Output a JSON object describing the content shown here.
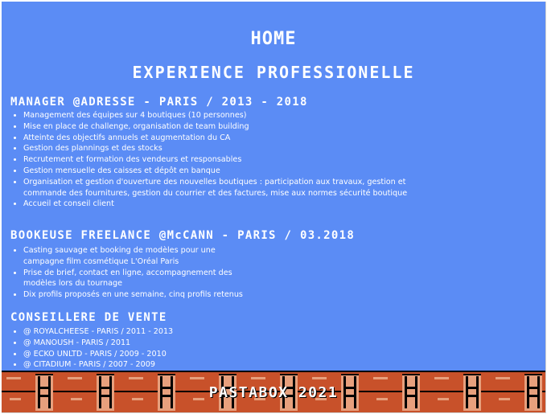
{
  "header": {
    "home": "HOME",
    "section_title": "EXPERIENCE PROFESSIONELLE"
  },
  "jobs": [
    {
      "title": "MANAGER @ADRESSE - PARIS / 2013 - 2018",
      "bullets": [
        "Management des équipes sur 4 boutiques (10 personnes)",
        "Mise en place de challenge, organisation de team building",
        "Atteinte des objectifs annuels et augmentation du CA",
        "Gestion des plannings et des stocks",
        "Recrutement et formation des vendeurs et responsables",
        "Gestion mensuelle des caisses et dépôt en banque",
        "Organisation et gestion d'ouverture des nouvelles boutiques : participation aux travaux, gestion et commande des fournitures, gestion du courrier et des factures, mise aux normes sécurité boutique",
        "Accueil et conseil client"
      ]
    },
    {
      "title": "BOOKEUSE FREELANCE @McCANN - PARIS / 03.2018",
      "bullets": [
        "Casting sauvage et booking de modèles pour une campagne film cosmétique L'Oréal Paris",
        "Prise de brief, contact en ligne, accompagnement des modèles lors du tournage",
        "Dix profils proposés en une semaine, cinq profils retenus"
      ]
    },
    {
      "title": "CONSEILLERE DE VENTE",
      "bullets": [
        "@ ROYALCHEESE - PARIS / 2011 - 2013",
        "@ MANOUSH - PARIS / 2011",
        "@ ECKO UNLTD - PARIS / 2009 - 2010",
        "@ CITADIUM - PARIS / 2007 - 2009"
      ]
    }
  ],
  "footer": {
    "text": "PASTABOX 2021"
  },
  "colors": {
    "background": "#5b8cf5",
    "brick": "#c8512a",
    "text": "#ffffff"
  }
}
